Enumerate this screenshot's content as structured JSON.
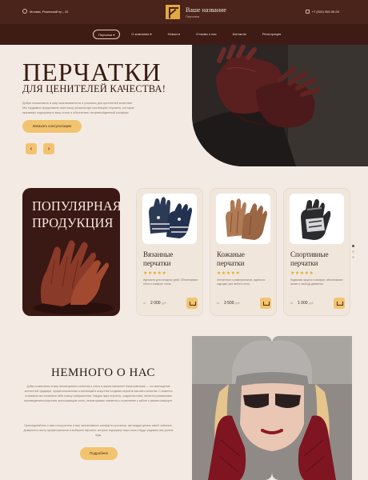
{
  "header": {
    "address": "Москва, Рязанский пр., 10",
    "brand_name": "Ваше название",
    "brand_tagline": "Перчатки",
    "phone": "+7 (000) 000-00-00"
  },
  "nav": {
    "items": [
      "Перчатки",
      "О компании",
      "Новости",
      "Отзывы о нас",
      "Контакты",
      "Регистрация"
    ],
    "active_index": 0
  },
  "hero": {
    "title": "ПЕРЧАТКИ",
    "subtitle": "ДЛЯ ЦЕНИТЕЛЕЙ КАЧЕСТВА!",
    "description": "Добро пожаловать в мир эксклюзивности и роскоши для ценителей качества! Мы гордимся представить вам нашу уникальную коллекцию перчаток, которые призваны подчеркнуть ваш стиль и обеспечить непревзойденный комфорт.",
    "button": "Заказать консультацию",
    "prev_arrow": "‹",
    "next_arrow": "›"
  },
  "popular": {
    "title_line1": "ПОПУЛЯРНАЯ",
    "title_line2": "ПРОДУКЦИЯ",
    "products": [
      {
        "name_line1": "Вязанные",
        "name_line2": "перчатки",
        "stars": "★★★★★",
        "rating": 5,
        "description": "Идеальны для холодных дней. Обеспечивают тепло и комфорт стиля.",
        "price_prefix": "от",
        "price": "2 000",
        "currency": "руб"
      },
      {
        "name_line1": "Кожаные",
        "name_line2": "перчатки",
        "stars": "★★★★★",
        "rating": 5,
        "description": "Элегантные и универсальные, идеально подходят для любого стиля.",
        "price_prefix": "от",
        "price": "3 500",
        "currency": "руб"
      },
      {
        "name_line1": "Спортивные",
        "name_line2": "перчатки",
        "stars": "★★★★★",
        "rating": 5,
        "description": "Надежная защита и комфорт, обеспечивают захват и свободу движения.",
        "price_prefix": "от",
        "price": "1 000",
        "currency": "руб"
      }
    ]
  },
  "about": {
    "title": "НЕМНОГО О НАС",
    "paragraph1": "Добро пожаловать в мир неповторимого качества и стиля в нашем магазине! Наша компания — это воплощение элегантной традиции, профессионализма и инноваций в искусстве создания перчаток высшего качества. С момента основания мы посвятили себя поиску совершенства. Каждая пара перчаток, созданная нами, является уникальным произведением искусства, воплощающим стиль, неповторимые элементы и стремление к заботе о вашем комфорте.",
    "paragraph2": "Присоединяйтесь к нам и погрузитесь в мир эксклюзивного комфорта и роскоши, где каждая деталь имеет значение. Доверьтесь опыту профессионалов и выберите перчатки, которые подчеркнут ваш стиль и будут радовать вас долгие годы.",
    "button": "Подробнее"
  },
  "colors": {
    "brown_dark": "#3e1c15",
    "header": "#4a231b",
    "accent": "#f2c46f",
    "background": "#f3ebe3"
  },
  "icons": [
    "map-pin-icon",
    "phone-icon",
    "logo-icon",
    "cart-icon",
    "arrow-left-icon",
    "arrow-right-icon"
  ]
}
